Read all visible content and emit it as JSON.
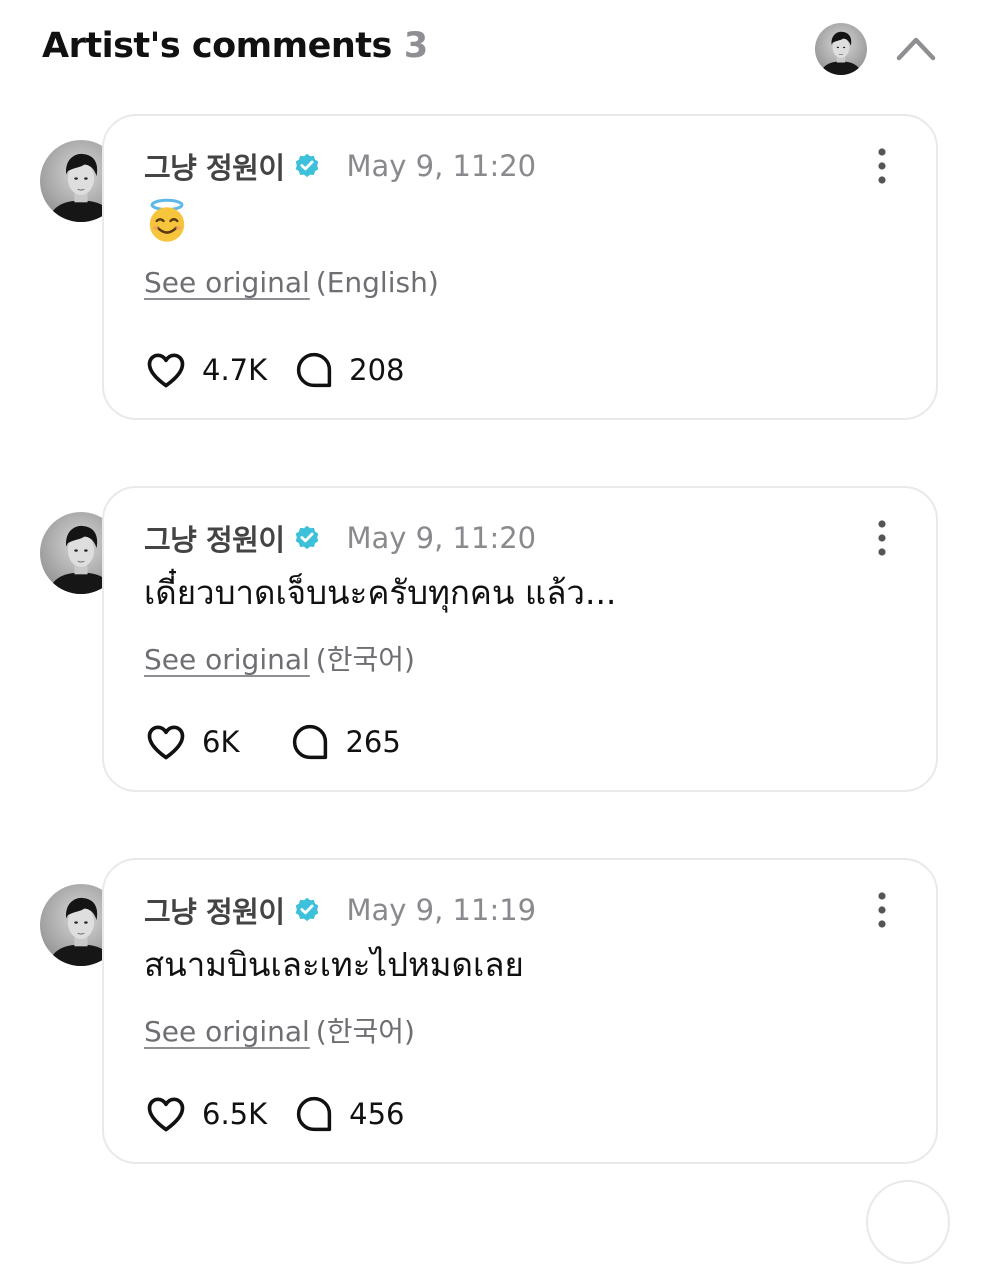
{
  "header": {
    "title": "Artist's comments",
    "count": "3"
  },
  "comments": [
    {
      "author": "그냥 정원이",
      "time": "May 9, 11:20",
      "body": "😇",
      "body_icon": "smiling-face-with-halo-emoji",
      "see_original_label": "See original",
      "language": "(English)",
      "likes": "4.7K",
      "replies": "208"
    },
    {
      "author": "그냥 정원이",
      "time": "May 9, 11:20",
      "body": "เดี๋ยวบาดเจ็บนะครับทุกคน แล้ว...",
      "see_original_label": "See original",
      "language": "(한국어)",
      "likes": "6K",
      "replies": "265"
    },
    {
      "author": "그냥 정원이",
      "time": "May 9, 11:19",
      "body": "สนามบินเละเทะไปหมดเลย",
      "see_original_label": "See original",
      "language": "(한국어)",
      "likes": "6.5K",
      "replies": "456"
    }
  ],
  "colors": {
    "verified": "#3dc0d9",
    "card_border": "#e9e9ec",
    "muted_text": "#8a8a8e"
  }
}
